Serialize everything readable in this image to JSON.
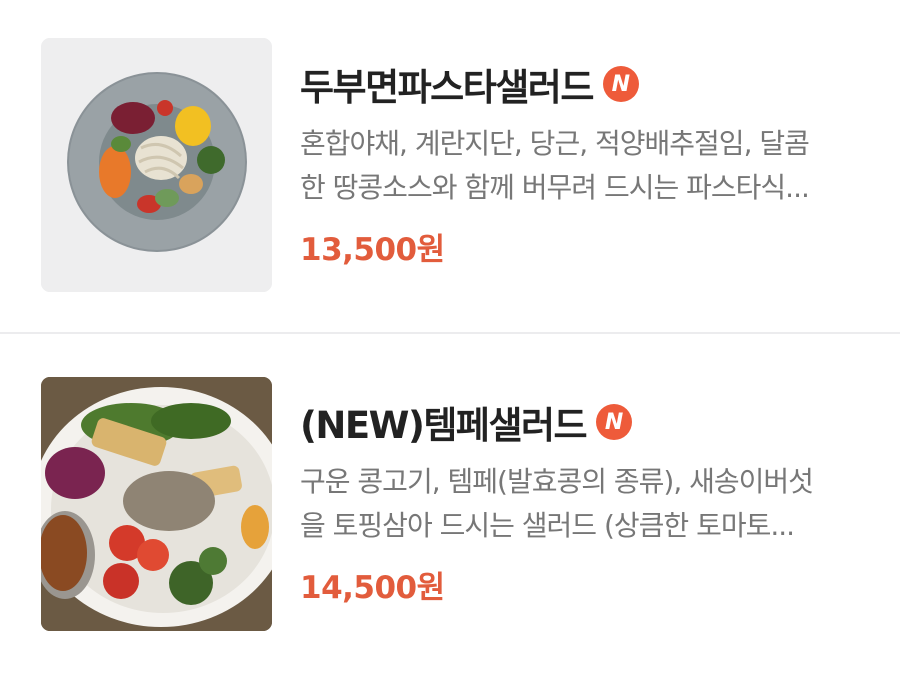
{
  "menu_items": [
    {
      "name": "두부면파스타샐러드",
      "badge": "N",
      "description_line1": "혼합야채, 계란지단, 당근, 적양배추절임, 달콤",
      "description_line2": "한 땅콩소스와 함께 버무려 드시는 파스타식...",
      "price": "13,500원",
      "image": "tofu-noodle-pasta-salad-photo"
    },
    {
      "name": "(NEW)템페샐러드",
      "badge": "N",
      "description_line1": "구운 콩고기, 템페(발효콩의 종류), 새송이버섯",
      "description_line2": "을 토핑삼아 드시는 샐러드 (상큼한 토마토...",
      "price": "14,500원",
      "image": "tempeh-salad-photo"
    }
  ],
  "colors": {
    "price": "#e25c3c",
    "badge": "#ee5b3a",
    "title": "#222222",
    "description": "#777777",
    "divider": "#ececee"
  }
}
